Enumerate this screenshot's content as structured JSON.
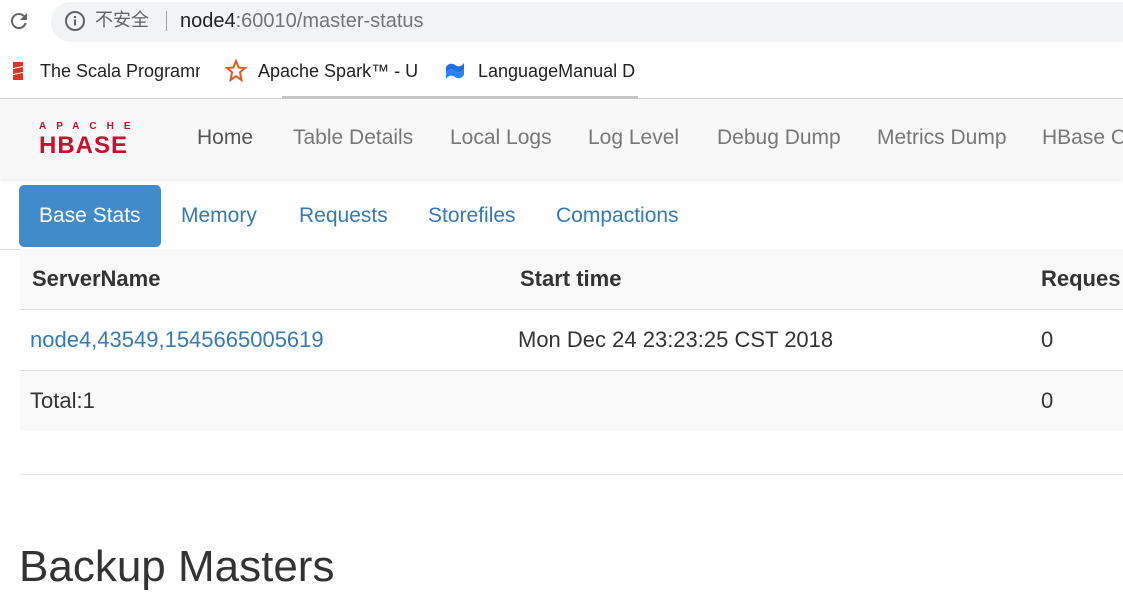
{
  "browser": {
    "security_label": "不安全",
    "url_host": "node4",
    "url_path": ":60010/master-status",
    "bookmarks": [
      {
        "label": "The Scala Programm",
        "icon": "scala-icon"
      },
      {
        "label": "Apache Spark™ - U",
        "icon": "spark-icon"
      },
      {
        "label": "LanguageManual D",
        "icon": "confluence-icon"
      }
    ]
  },
  "navbar": {
    "logo_top": "APACHE",
    "logo_main": "HBASE",
    "items": [
      "Home",
      "Table Details",
      "Local Logs",
      "Log Level",
      "Debug Dump",
      "Metrics Dump",
      "HBase Co"
    ]
  },
  "tabs": [
    "Base Stats",
    "Memory",
    "Requests",
    "Storefiles",
    "Compactions"
  ],
  "table": {
    "headers": [
      "ServerName",
      "Start time",
      "Reques"
    ],
    "rows": [
      [
        "node4,43549,1545665005619",
        "Mon Dec 24 23:23:25 CST 2018",
        "0"
      ]
    ],
    "total": [
      "Total:1",
      "",
      "0"
    ]
  },
  "section": {
    "title": "Backup Masters"
  },
  "colors": {
    "link": "#337ab7",
    "active_tab": "#428bca",
    "hbase_red": "#c8102e"
  }
}
